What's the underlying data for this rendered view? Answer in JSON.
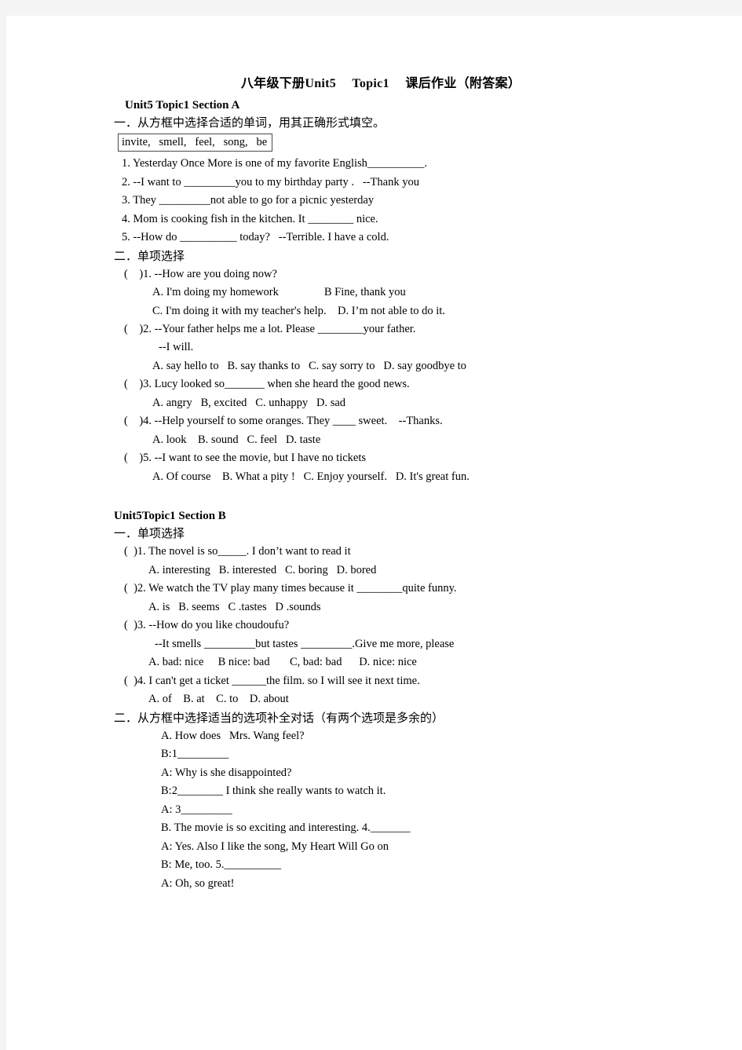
{
  "document": {
    "title": "八年级下册Unit5　 Topic1　 课后作业（附答案）"
  },
  "section_a": {
    "heading": "Unit5 Topic1 Section A",
    "part_one": {
      "directive": "一．从方框中选择合适的单词，用其正确形式填空。",
      "word_box": "invite,   smell,   feel,   song,   be",
      "questions": [
        "1. Yesterday Once More is one of my favorite English__________.",
        "2. --I want to _________you to my birthday party .   --Thank you",
        "3. They _________not able to go for a picnic yesterday",
        "4. Mom is cooking fish in the kitchen. It ________ nice.",
        "5. --How do __________ today?   --Terrible. I have a cold."
      ]
    },
    "part_two": {
      "directive": "二．单项选择",
      "items": [
        {
          "stem": "(    )1. --How are you doing now?",
          "options": [
            "A. I'm doing my homework                B Fine, thank you",
            "C. I'm doing it with my teacher's help.    D. I’m not able to do it."
          ]
        },
        {
          "stem": "(    )2. --Your father helps me a lot. Please ________your father.",
          "reply": "--I will.",
          "options": [
            "A. say hello to   B. say thanks to   C. say sorry to   D. say goodbye to"
          ]
        },
        {
          "stem": "(    )3. Lucy looked so_______ when she heard the good news.",
          "options": [
            "A. angry   B, excited   C. unhappy   D. sad"
          ]
        },
        {
          "stem": "(    )4. --Help yourself to some oranges. They ____ sweet.    --Thanks.",
          "options": [
            "A. look    B. sound   C. feel   D. taste"
          ]
        },
        {
          "stem": "(    )5. --I want to see the movie, but I have no tickets",
          "options": [
            "A. Of course    B. What a pity !   C. Enjoy yourself.   D. It's great fun."
          ]
        }
      ]
    }
  },
  "section_b": {
    "heading": "Unit5Topic1 Section B",
    "part_one": {
      "directive": "一．单项选择",
      "items": [
        {
          "stem": "(  )1. The novel is so_____. I don’t want to read it",
          "options": [
            "A. interesting   B. interested   C. boring   D. bored"
          ]
        },
        {
          "stem": "(  )2. We watch the TV play many times because it ________quite funny.",
          "options": [
            "A. is   B. seems   C .tastes   D .sounds"
          ]
        },
        {
          "stem": "(  )3. --How do you like choudoufu?",
          "reply": "--It smells _________but tastes _________.Give me more, please",
          "options": [
            "A. bad: nice     B nice: bad       C, bad: bad      D. nice: nice"
          ]
        },
        {
          "stem": "(  )4. I can't get a ticket ______the film. so I will see it next time.",
          "options": [
            "A. of    B. at    C. to    D. about"
          ]
        }
      ]
    },
    "part_two": {
      "directive": "二．从方框中选择适当的选项补全对话（有两个选项是多余的）",
      "dialogue": [
        "A. How does   Mrs. Wang feel?",
        "B:1_________",
        "A: Why is she disappointed?",
        "B:2________ I think she really wants to watch it.",
        "A: 3_________",
        "B. The movie is so exciting and interesting. 4._______",
        "A: Yes. Also I like the song, My Heart Will Go on",
        "B: Me, too. 5.__________",
        "A: Oh, so great!"
      ]
    }
  }
}
